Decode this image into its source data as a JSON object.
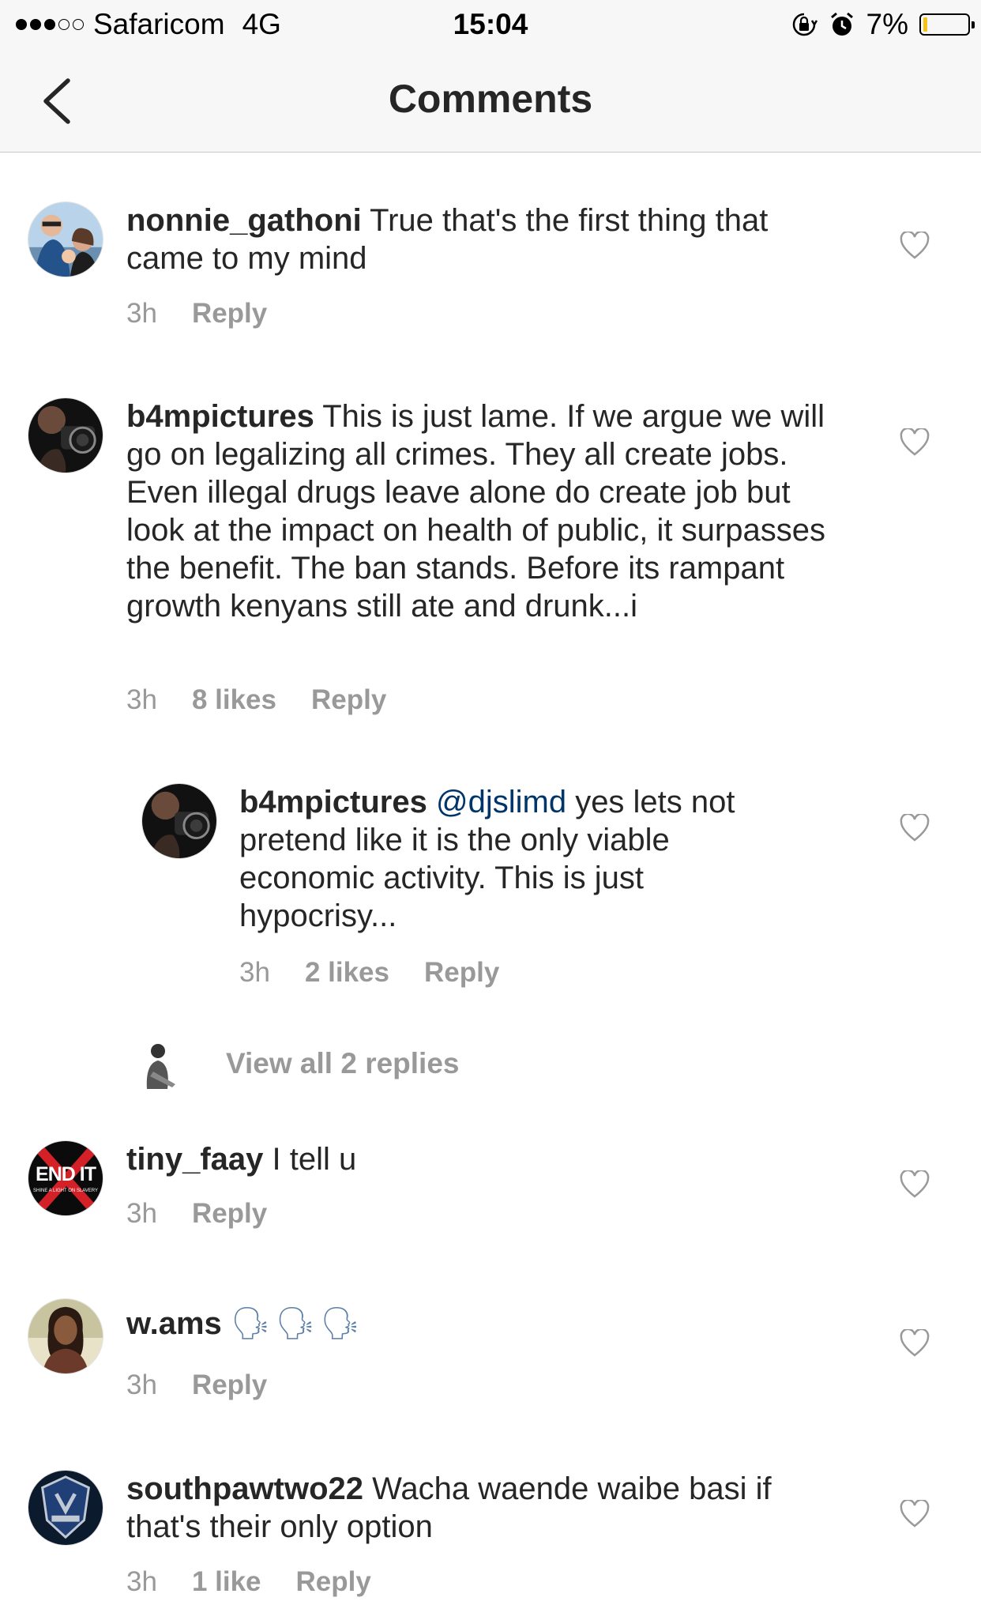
{
  "status_bar": {
    "carrier": "Safaricom",
    "network": "4G",
    "time": "15:04",
    "battery": "7%",
    "icons": [
      "signal-dots-icon",
      "orientation-lock-icon",
      "alarm-icon",
      "battery-icon"
    ]
  },
  "nav": {
    "title": "Comments",
    "back_icon": "chevron-left-icon"
  },
  "comments": [
    {
      "username": "nonnie_gathoni",
      "text": "True that's the first thing that came to my mind",
      "time": "3h",
      "likes": "",
      "reply_label": "Reply"
    },
    {
      "username": "b4mpictures",
      "text": "This is just lame. If we argue we will go on legalizing all crimes. They all create jobs. Even illegal drugs leave alone do create job but look at the impact on health of public, it surpasses the benefit. The ban stands. Before its rampant growth kenyans still ate and drunk...i",
      "time": "3h",
      "likes": "8 likes",
      "reply_label": "Reply"
    },
    {
      "username": "b4mpictures",
      "mention": "@djslimd",
      "text": "yes lets not pretend like it is the only viable economic activity. This  is just hypocrisy...",
      "time": "3h",
      "likes": "2 likes",
      "reply_label": "Reply"
    },
    {
      "username": "tiny_faay",
      "text": "I tell u",
      "time": "3h",
      "likes": "",
      "reply_label": "Reply"
    },
    {
      "username": "w.ams",
      "text": "🗣🗣🗣",
      "time": "3h",
      "likes": "",
      "reply_label": "Reply"
    },
    {
      "username": "southpawtwo22",
      "text": "Wacha waende waibe basi if that's their only option",
      "time": "3h",
      "likes": "1 like",
      "reply_label": "Reply"
    }
  ],
  "view_replies_label": "View all 2 replies",
  "avatar_logo_text": {
    "endit": "END IT",
    "endit_sub": "SHINE A LIGHT ON SLAVERY"
  }
}
